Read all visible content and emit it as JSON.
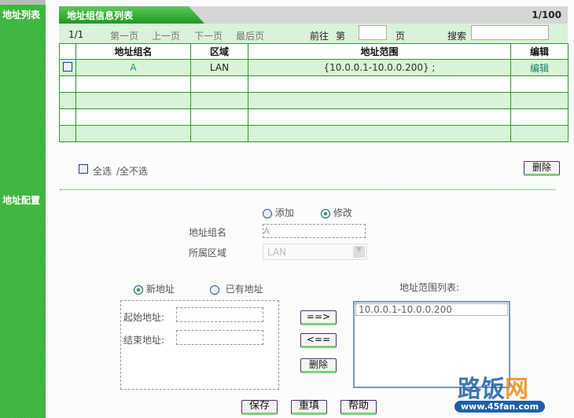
{
  "sidebar": {
    "list_label": "地址列表",
    "config_label": "地址配置"
  },
  "list": {
    "title": "地址组信息列表",
    "page_count": "1/100",
    "pager": {
      "current": "1/1",
      "first": "第一页",
      "prev": "上一页",
      "next": "下一页",
      "last": "最后页",
      "goto": "前往",
      "page_prefix": "第",
      "page_suffix": "页",
      "search": "搜索",
      "page_value": "",
      "search_value": ""
    },
    "columns": [
      "地址组名",
      "区域",
      "地址范围",
      "编辑"
    ],
    "rows": [
      {
        "name": "A",
        "zone": "LAN",
        "range": "{10.0.0.1-10.0.0.200} ;",
        "edit": "编辑"
      }
    ],
    "select_all": "全选",
    "select_none": "/全不选",
    "delete": "删除"
  },
  "config": {
    "mode_add": "添加",
    "mode_edit": "修改",
    "mode_selected": "修改",
    "group_name_label": "地址组名",
    "group_name_value": "A",
    "zone_label": "所属区域",
    "zone_value": "LAN",
    "new_addr": "新地址",
    "existing_addr": "已有地址",
    "start_label": "起始地址:",
    "end_label": "结束地址:",
    "start_value": "",
    "end_value": "",
    "add_btn": "==>",
    "remove_btn": "<==",
    "delete_btn": "删除",
    "range_list_label": "地址范围列表:",
    "range_items": [
      "10.0.0.1-10.0.0.200"
    ],
    "save": "保存",
    "reset": "重填",
    "help": "帮助"
  },
  "watermark": {
    "text": "路饭网",
    "url": "www.45fan.com"
  }
}
